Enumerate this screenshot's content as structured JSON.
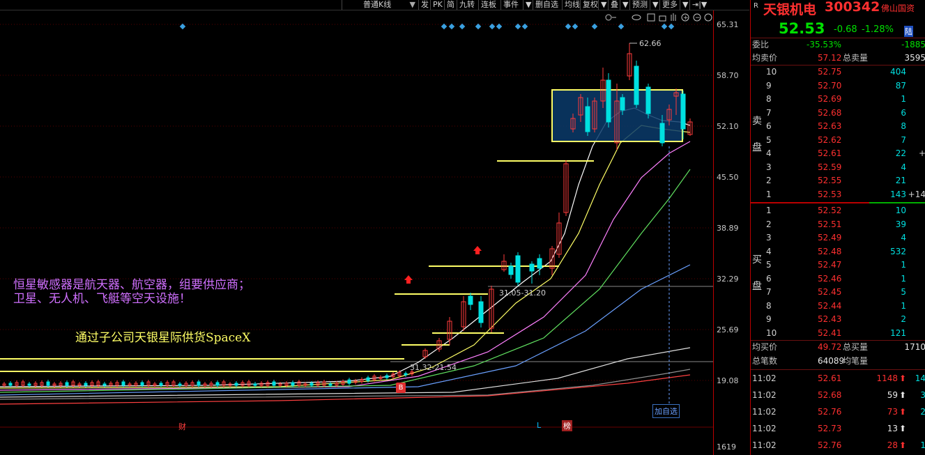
{
  "toolbar": {
    "kline_type": "普通K线",
    "buttons": [
      "发",
      "PK",
      "简",
      "九转",
      "连板",
      "事件",
      "删自选",
      "均线",
      "复权",
      "叠",
      "预测",
      "更多"
    ]
  },
  "chart": {
    "y_ticks": [
      "65.31",
      "58.70",
      "52.10",
      "45.50",
      "38.89",
      "32.29",
      "25.69",
      "19.08"
    ],
    "high_label": "62.66",
    "range_label_1": "31.05-31.20",
    "range_label_2": "31.32-21.54",
    "note_line_1": "恒星敏感器是航天器、航空器，组要供应商；",
    "note_line_2": "卫星、无人机、飞艇等空天设施！",
    "note_line_3": "通过子公司天银星际供货SpaceX",
    "marker_b": "B",
    "marker_cai": "财",
    "marker_l": "L",
    "marker_bang": "榜",
    "add_watch": "加自选",
    "volume_tick": "1619",
    "colors": {
      "up": "#ff3b3b",
      "down": "#00e0e0",
      "hline": "#ffff66",
      "box": "#ffff66"
    }
  },
  "panel": {
    "tag": "R",
    "stock_name": "天银机电",
    "stock_code": "300342",
    "concept": "佛山国资",
    "price": "52.53",
    "change": "-0.68",
    "change_pct": "-1.28%",
    "market": "陆",
    "weibi_label": "委比",
    "weibi_value": "-35.53%",
    "weicha_value": "-1885",
    "avg_sell_label": "均卖价",
    "avg_sell_value": "57.12",
    "total_sell_label": "总卖量",
    "total_sell_value": "3595",
    "sell_side_label_1": "卖",
    "sell_side_label_2": "盘",
    "sells": [
      {
        "idx": "10",
        "price": "52.75",
        "vol": "404",
        "extra": ""
      },
      {
        "idx": "9",
        "price": "52.70",
        "vol": "87",
        "extra": ""
      },
      {
        "idx": "8",
        "price": "52.69",
        "vol": "1",
        "extra": ""
      },
      {
        "idx": "7",
        "price": "52.68",
        "vol": "6",
        "extra": ""
      },
      {
        "idx": "6",
        "price": "52.63",
        "vol": "8",
        "extra": ""
      },
      {
        "idx": "5",
        "price": "52.62",
        "vol": "7",
        "extra": ""
      },
      {
        "idx": "4",
        "price": "52.61",
        "vol": "22",
        "extra": "+"
      },
      {
        "idx": "3",
        "price": "52.59",
        "vol": "4",
        "extra": ""
      },
      {
        "idx": "2",
        "price": "52.55",
        "vol": "21",
        "extra": ""
      },
      {
        "idx": "1",
        "price": "52.53",
        "vol": "143",
        "extra": "+14"
      }
    ],
    "buy_side_label_1": "买",
    "buy_side_label_2": "盘",
    "buys": [
      {
        "idx": "1",
        "price": "52.52",
        "vol": "10",
        "extra": ""
      },
      {
        "idx": "2",
        "price": "52.51",
        "vol": "39",
        "extra": ""
      },
      {
        "idx": "3",
        "price": "52.49",
        "vol": "4",
        "extra": ""
      },
      {
        "idx": "4",
        "price": "52.48",
        "vol": "532",
        "extra": ""
      },
      {
        "idx": "5",
        "price": "52.47",
        "vol": "1",
        "extra": ""
      },
      {
        "idx": "6",
        "price": "52.46",
        "vol": "1",
        "extra": ""
      },
      {
        "idx": "7",
        "price": "52.45",
        "vol": "5",
        "extra": ""
      },
      {
        "idx": "8",
        "price": "52.44",
        "vol": "1",
        "extra": ""
      },
      {
        "idx": "9",
        "price": "52.43",
        "vol": "2",
        "extra": ""
      },
      {
        "idx": "10",
        "price": "52.41",
        "vol": "121",
        "extra": ""
      }
    ],
    "avg_buy_label": "均买价",
    "avg_buy_value": "49.72",
    "total_buy_label": "总买量",
    "total_buy_value": "1710",
    "total_deals_label": "总笔数",
    "total_deals_value": "64089",
    "avg_deal_label": "均笔量",
    "ticks": [
      {
        "time": "11:02",
        "price": "52.61",
        "vol": "1148",
        "dir": "up",
        "n": "14"
      },
      {
        "time": "11:02",
        "price": "52.68",
        "vol": "59",
        "dir": "up-white",
        "n": "3"
      },
      {
        "time": "11:02",
        "price": "52.76",
        "vol": "73",
        "dir": "up",
        "n": "2"
      },
      {
        "time": "11:02",
        "price": "52.73",
        "vol": "13",
        "dir": "up-white",
        "n": ""
      },
      {
        "time": "11:02",
        "price": "52.76",
        "vol": "28",
        "dir": "up",
        "n": "1"
      }
    ]
  }
}
